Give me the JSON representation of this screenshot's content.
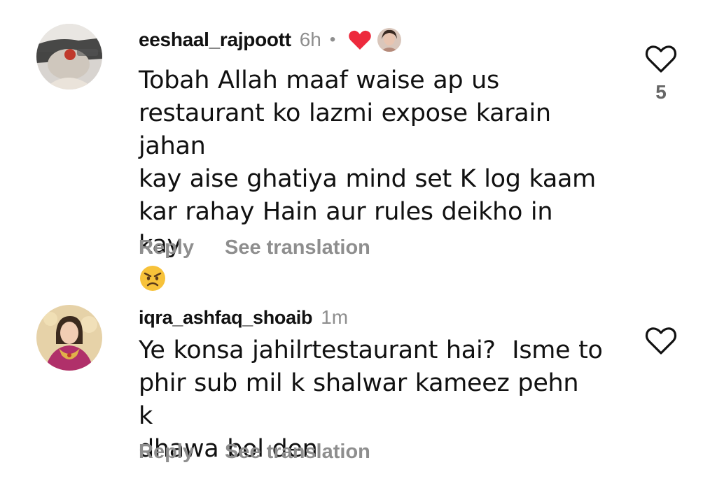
{
  "comments": [
    {
      "username": "eeshaal_rajpoott",
      "time": "6h",
      "separator": "•",
      "creator_liked": true,
      "text_lines": [
        "Tobah Allah maaf waise ap us",
        "restaurant ko lazmi expose karain jahan",
        "kay aise ghatiya mind set K log kaam",
        "kar rahay Hain aur rules deikho in kay"
      ],
      "emoji": "angry-face",
      "reply_label": "Reply",
      "translate_label": "See translation",
      "like_count": "5",
      "like_icon": "heart-outline-icon"
    },
    {
      "username": "iqra_ashfaq_shoaib",
      "time": "1m",
      "text_lines": [
        "Ye konsa jahilrtestaurant hai?  Isme to",
        "phir sub mil k shalwar kameez pehn k",
        "dhawa bol den"
      ],
      "reply_label": "Reply",
      "translate_label": "See translation",
      "like_icon": "heart-outline-icon"
    }
  ],
  "colors": {
    "text": "#111111",
    "secondary": "#8e8e8e",
    "creator_heart": "#ed2a3d",
    "background": "#ffffff"
  }
}
